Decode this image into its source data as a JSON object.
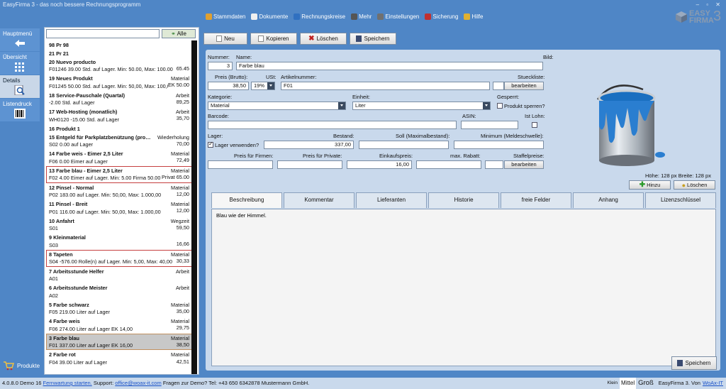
{
  "window": {
    "title": "EasyFirma 3 - das noch bessere Rechnungsprogramm",
    "controls": "– ▫ ✕"
  },
  "toolbar": [
    {
      "label": "Stammdaten",
      "color": "#e0a030"
    },
    {
      "label": "Dokumente",
      "color": "#f0f0f0"
    },
    {
      "label": "Rechnungskreise",
      "color": "#3070c0"
    },
    {
      "label": "Mehr",
      "color": "#555555"
    },
    {
      "label": "Einstellungen",
      "color": "#707070"
    },
    {
      "label": "Sicherung",
      "color": "#c03030"
    },
    {
      "label": "Hilfe",
      "color": "#e0b030"
    }
  ],
  "logo": {
    "line1": "EASY",
    "line2": "FIRMA",
    "num": "3"
  },
  "nav": {
    "items": [
      "Hauptmenü",
      "Übersicht",
      "Details",
      "Listendruck"
    ],
    "selected": "Details",
    "bottom": "Produkte"
  },
  "list": {
    "search_value": "",
    "all_label": "Alle",
    "items": [
      {
        "name": "98 Pr 98",
        "type": "",
        "desc": "",
        "price": "",
        "one": true
      },
      {
        "name": "21 Pr 21",
        "type": "",
        "desc": "",
        "price": "",
        "one": true
      },
      {
        "name": "20 Nuevo producto",
        "type": "",
        "desc": "F01246 39.00 Std. auf Lager. Min: 50.00, Max: 100.00",
        "price": "65.45"
      },
      {
        "name": "19 Neues Produkt",
        "type": "Material",
        "desc": "F01245 50.00 Std. auf Lager. Min: 50,00, Max: 100,00",
        "price": "EK 50.00"
      },
      {
        "name": "18 Service-Pauschale (Quartal)",
        "type": "Arbeit",
        "desc": "-2.00 Std. auf Lager",
        "price": "89,25"
      },
      {
        "name": "17 Web-Hosting (monatlich)",
        "type": "Arbeit",
        "desc": "WH0120 -15.00 Std. auf Lager",
        "price": "35,70"
      },
      {
        "name": "16 Produkt 1",
        "type": "",
        "desc": "",
        "price": "",
        "one": true
      },
      {
        "name": "15 Entgeld für Parkplatzbenützung (pro…",
        "type": "Wiederholung",
        "desc": "S02 0.00 auf Lager",
        "price": "70,00"
      },
      {
        "name": "14 Farbe weis - Eimer 2,5 Liter",
        "type": "Material",
        "desc": "F06 0.00 Eimer auf Lager",
        "price": "72,49"
      },
      {
        "name": "13 Farbe blau - Eimer 2,5 Liter",
        "type": "Material",
        "desc": "F02 4.00 Eimer auf Lager. Min: 5.00 Firma 50.00",
        "price": "Privat 65.00",
        "red": true
      },
      {
        "name": "12 Pinsel - Normal",
        "type": "Material",
        "desc": "P02 183.00 auf Lager. Min: 50,00, Max: 1.000,00",
        "price": "12,00"
      },
      {
        "name": "11 Pinsel - Breit",
        "type": "Material",
        "desc": "P01 116.00 auf Lager. Min: 50,00, Max: 1.000,00",
        "price": "12,00"
      },
      {
        "name": "10 Anfahrt",
        "type": "Wegzeit",
        "desc": "S01",
        "price": "59,50"
      },
      {
        "name": "9 Kleinmaterial",
        "type": "",
        "desc": "S03",
        "price": "16,66"
      },
      {
        "name": "8 Tapeten",
        "type": "Material",
        "desc": "S04 -576.00 Rolle(n) auf Lager. Min: 5,00, Max: 40,00",
        "price": "30,33",
        "red": true
      },
      {
        "name": "7 Arbeitsstunde Helfer",
        "type": "Arbeit",
        "desc": "A01",
        "price": ""
      },
      {
        "name": "6 Arbeitsstunde Meister",
        "type": "Arbeit",
        "desc": "A02",
        "price": ""
      },
      {
        "name": "5 Farbe schwarz",
        "type": "Material",
        "desc": "F05 219.00 Liter auf Lager",
        "price": "35,00"
      },
      {
        "name": "4 Farbe weis",
        "type": "Material",
        "desc": "F06 274.00 Liter auf Lager EK 14,00",
        "price": "29,75"
      },
      {
        "name": "3 Farbe blau",
        "type": "Material",
        "desc": "F01 337.00 Liter auf Lager EK 16,00",
        "price": "38,50",
        "sel": true
      },
      {
        "name": "2 Farbe rot",
        "type": "Material",
        "desc": "F04 39.00 Liter auf Lager",
        "price": "42,51"
      }
    ]
  },
  "buttons": {
    "new": "Neu",
    "copy": "Kopieren",
    "delete": "Löschen",
    "save": "Speichern"
  },
  "form": {
    "labels": {
      "nummer": "Nummer:",
      "name": "Name:",
      "bild": "Bild:",
      "preis": "Preis (Brutto):",
      "ust": "USt:",
      "artikelnummer": "Artikelnummer:",
      "stueckliste": "Stueckliste:",
      "kategorie": "Kategorie:",
      "einheit": "Einheit:",
      "gesperrt": "Gesperrt:",
      "produkt_sperren": "Produkt sperren?",
      "barcode": "Barcode:",
      "asin": "ASIN:",
      "ist_lohn": "Ist Lohn:",
      "lager": "Lager:",
      "lager_verwenden": "Lager verwenden?",
      "bestand": "Bestand:",
      "soll": "Soll (Maximalbestand):",
      "minimum": "Minimum (Meldeschwelle):",
      "preis_firmen": "Preis für Firmen:",
      "preis_private": "Preis für Private:",
      "einkaufspreis": "Einkaufspreis:",
      "max_rabatt": "max. Rabatt:",
      "staffelpreise": "Staffelpreise:"
    },
    "values": {
      "nummer": "3",
      "name": "Farbe blau",
      "preis": "38,50",
      "ust": "19%",
      "artikelnummer": "F01",
      "kategorie": "Material",
      "einheit": "Liter",
      "bestand": "337,00",
      "einkaufspreis": "16,00"
    },
    "bearbeiten": "bearbeiten",
    "image_size": "Höhe: 128 px Breite: 128 px",
    "hinzu": "Hinzu",
    "loeschen": "Löschen"
  },
  "tabs": {
    "items": [
      "Beschreibung",
      "Kommentar",
      "Lieferanten",
      "Historie",
      "freie Felder",
      "Anhang",
      "Lizenzschlüssel"
    ],
    "active": "Beschreibung",
    "content": "Blau wie der Himmel."
  },
  "footer": {
    "version": "4.0.8.0 Demo 16",
    "link1": "Fernwartung starten.",
    "support": "Support:",
    "email": "office@woax-it.com",
    "rest": "Fragen zur Demo? Tel: +43 650 6342878 Mustermann GmbH.",
    "sizes": [
      "Klein",
      "Mittel",
      "Groß"
    ],
    "right": "EasyFirma 3. Von",
    "link2": "WoAx-IT"
  }
}
